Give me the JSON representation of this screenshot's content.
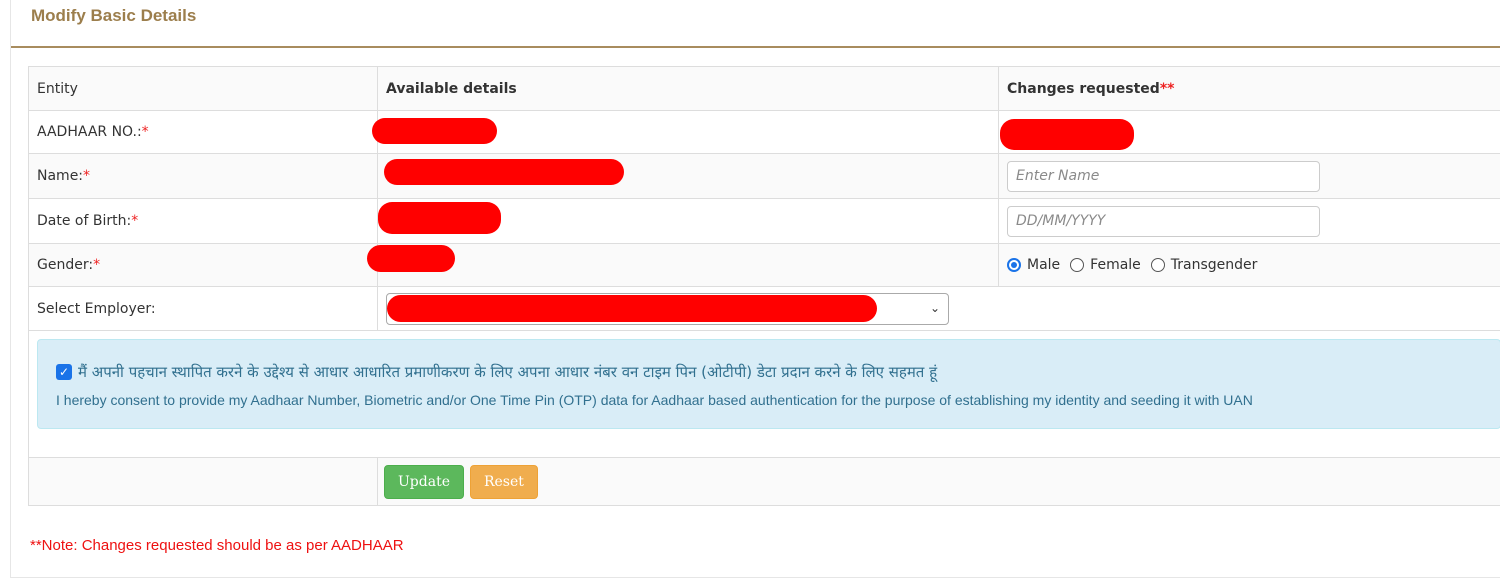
{
  "panel": {
    "title": "Modify Basic Details"
  },
  "table": {
    "headers": {
      "entity": "Entity",
      "available": "Available details",
      "changes": "Changes requested",
      "changes_marker": "**"
    },
    "rows": {
      "aadhaar": {
        "label": "AADHAAR NO.:",
        "req": "*"
      },
      "name": {
        "label": "Name:",
        "req": "*",
        "placeholder": "Enter Name"
      },
      "dob": {
        "label": "Date of Birth:",
        "req": "*",
        "placeholder": "DD/MM/YYYY"
      },
      "gender": {
        "label": "Gender:",
        "req": "*",
        "options": [
          "Male",
          "Female",
          "Transgender"
        ],
        "selected": "Male"
      },
      "employer": {
        "label": "Select Employer:"
      }
    }
  },
  "consent": {
    "checked": true,
    "hindi": "मैं अपनी पहचान स्थापित करने के उद्देश्य से आधार आधारित प्रमाणीकरण के लिए अपना आधार नंबर वन टाइम पिन (ओटीपी) डेटा प्रदान करने के लिए सहमत हूं",
    "english": "I hereby consent to provide my Aadhaar Number, Biometric and/or One Time Pin (OTP) data for Aadhaar based authentication for the purpose of establishing my identity and seeding it with UAN"
  },
  "buttons": {
    "update": "Update",
    "reset": "Reset"
  },
  "note": "**Note: Changes requested should be as per AADHAAR",
  "colors": {
    "title": "#9c7e4c",
    "redaction": "#ff0000",
    "update": "#5cb85c",
    "reset": "#f0ad4e",
    "consent_bg": "#d9edf7"
  }
}
